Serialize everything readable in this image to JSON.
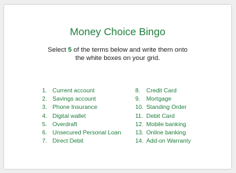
{
  "title": "Money Choice Bingo",
  "instructions": {
    "before": "Select ",
    "count": "5",
    "line1_after": " of the terms below and write them onto",
    "line2": "the white boxes on your grid."
  },
  "terms_left": [
    {
      "num": "1.",
      "label": "Current account"
    },
    {
      "num": "2.",
      "label": "Savings account"
    },
    {
      "num": "3.",
      "label": "Phone Insurance"
    },
    {
      "num": "4.",
      "label": "Digital wallet"
    },
    {
      "num": "5.",
      "label": "Overdraft"
    },
    {
      "num": "6.",
      "label": "Unsecured Personal Loan"
    },
    {
      "num": "7.",
      "label": "Direct Debit"
    }
  ],
  "terms_right": [
    {
      "num": "8.",
      "label": "Credit Card"
    },
    {
      "num": "9.",
      "label": "Mortgage"
    },
    {
      "num": "10.",
      "label": "Standing Order"
    },
    {
      "num": "11.",
      "label": "Debit Card"
    },
    {
      "num": "12.",
      "label": "Mobile banking"
    },
    {
      "num": "13.",
      "label": "Online banking"
    },
    {
      "num": "14.",
      "label": "Add-on Warranty"
    }
  ],
  "colors": {
    "accent": "#1e7d3b",
    "text": "#1a1a1a",
    "background": "#ffffff"
  }
}
